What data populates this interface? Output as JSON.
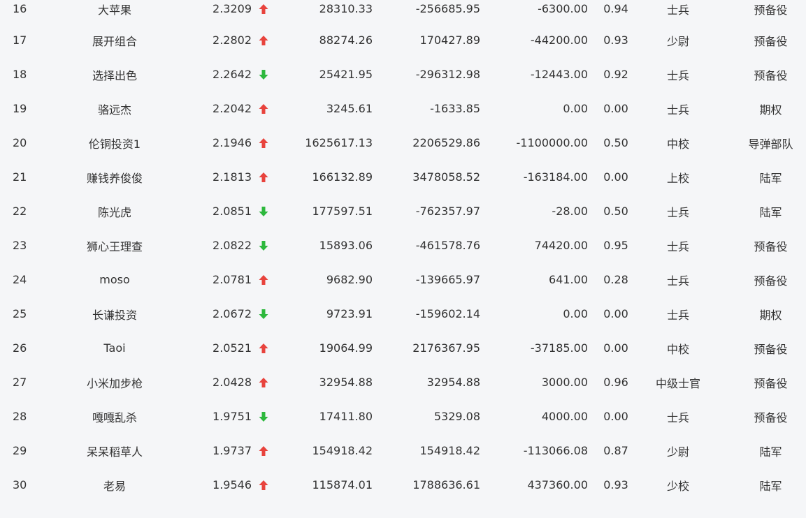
{
  "colors": {
    "up": "#e8433d",
    "down": "#2db83d",
    "text": "#333333",
    "background": "#f5f6f8"
  },
  "rows": [
    {
      "rank": "16",
      "name": "大苹果",
      "score": "2.3209",
      "trend": "up",
      "v1": "28310.33",
      "v2": "-256685.95",
      "v3": "-6300.00",
      "ratio": "0.94",
      "title": "士兵",
      "unit": "预备役"
    },
    {
      "rank": "17",
      "name": "展开组合",
      "score": "2.2802",
      "trend": "up",
      "v1": "88274.26",
      "v2": "170427.89",
      "v3": "-44200.00",
      "ratio": "0.93",
      "title": "少尉",
      "unit": "预备役"
    },
    {
      "rank": "18",
      "name": "选择出色",
      "score": "2.2642",
      "trend": "down",
      "v1": "25421.95",
      "v2": "-296312.98",
      "v3": "-12443.00",
      "ratio": "0.92",
      "title": "士兵",
      "unit": "预备役"
    },
    {
      "rank": "19",
      "name": "骆远杰",
      "score": "2.2042",
      "trend": "up",
      "v1": "3245.61",
      "v2": "-1633.85",
      "v3": "0.00",
      "ratio": "0.00",
      "title": "士兵",
      "unit": "期权"
    },
    {
      "rank": "20",
      "name": "伦铜投资1",
      "score": "2.1946",
      "trend": "up",
      "v1": "1625617.13",
      "v2": "2206529.86",
      "v3": "-1100000.00",
      "ratio": "0.50",
      "title": "中校",
      "unit": "导弹部队"
    },
    {
      "rank": "21",
      "name": "赚钱养俊俊",
      "score": "2.1813",
      "trend": "up",
      "v1": "166132.89",
      "v2": "3478058.52",
      "v3": "-163184.00",
      "ratio": "0.00",
      "title": "上校",
      "unit": "陆军"
    },
    {
      "rank": "22",
      "name": "陈光虎",
      "score": "2.0851",
      "trend": "down",
      "v1": "177597.51",
      "v2": "-762357.97",
      "v3": "-28.00",
      "ratio": "0.50",
      "title": "士兵",
      "unit": "陆军"
    },
    {
      "rank": "23",
      "name": "狮心王理查",
      "score": "2.0822",
      "trend": "down",
      "v1": "15893.06",
      "v2": "-461578.76",
      "v3": "74420.00",
      "ratio": "0.95",
      "title": "士兵",
      "unit": "预备役"
    },
    {
      "rank": "24",
      "name": "moso",
      "score": "2.0781",
      "trend": "up",
      "v1": "9682.90",
      "v2": "-139665.97",
      "v3": "641.00",
      "ratio": "0.28",
      "title": "士兵",
      "unit": "预备役"
    },
    {
      "rank": "25",
      "name": "长谦投资",
      "score": "2.0672",
      "trend": "down",
      "v1": "9723.91",
      "v2": "-159602.14",
      "v3": "0.00",
      "ratio": "0.00",
      "title": "士兵",
      "unit": "期权"
    },
    {
      "rank": "26",
      "name": "Taoi",
      "score": "2.0521",
      "trend": "up",
      "v1": "19064.99",
      "v2": "2176367.95",
      "v3": "-37185.00",
      "ratio": "0.00",
      "title": "中校",
      "unit": "预备役"
    },
    {
      "rank": "27",
      "name": "小米加步枪",
      "score": "2.0428",
      "trend": "up",
      "v1": "32954.88",
      "v2": "32954.88",
      "v3": "3000.00",
      "ratio": "0.96",
      "title": "中级士官",
      "unit": "预备役"
    },
    {
      "rank": "28",
      "name": "嘎嘎乱杀",
      "score": "1.9751",
      "trend": "down",
      "v1": "17411.80",
      "v2": "5329.08",
      "v3": "4000.00",
      "ratio": "0.00",
      "title": "士兵",
      "unit": "预备役"
    },
    {
      "rank": "29",
      "name": "呆呆稻草人",
      "score": "1.9737",
      "trend": "up",
      "v1": "154918.42",
      "v2": "154918.42",
      "v3": "-113066.08",
      "ratio": "0.87",
      "title": "少尉",
      "unit": "陆军"
    },
    {
      "rank": "30",
      "name": "老易",
      "score": "1.9546",
      "trend": "up",
      "v1": "115874.01",
      "v2": "1788636.61",
      "v3": "437360.00",
      "ratio": "0.93",
      "title": "少校",
      "unit": "陆军"
    }
  ]
}
